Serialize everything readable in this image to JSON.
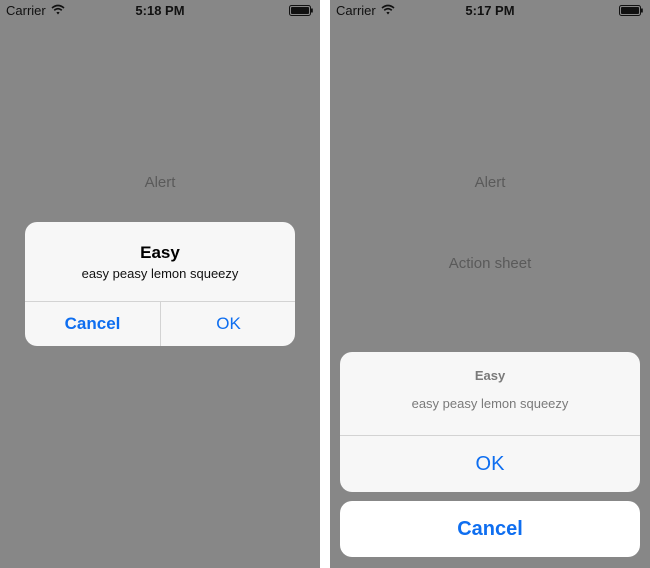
{
  "left_screen": {
    "status_bar": {
      "carrier": "Carrier",
      "time": "5:18 PM"
    },
    "background_labels": {
      "alert": "Alert"
    },
    "alert": {
      "title": "Easy",
      "message": "easy peasy lemon squeezy",
      "cancel_label": "Cancel",
      "ok_label": "OK"
    }
  },
  "right_screen": {
    "status_bar": {
      "carrier": "Carrier",
      "time": "5:17 PM"
    },
    "background_labels": {
      "alert": "Alert",
      "action_sheet": "Action sheet"
    },
    "action_sheet": {
      "title": "Easy",
      "message": "easy peasy lemon squeezy",
      "ok_label": "OK",
      "cancel_label": "Cancel"
    }
  },
  "colors": {
    "dim_background": "#878787",
    "dialog_background": "#f7f7f7",
    "accent_blue": "#0e6ef0"
  },
  "icons": {
    "wifi": "wifi-icon",
    "battery": "battery-icon"
  }
}
